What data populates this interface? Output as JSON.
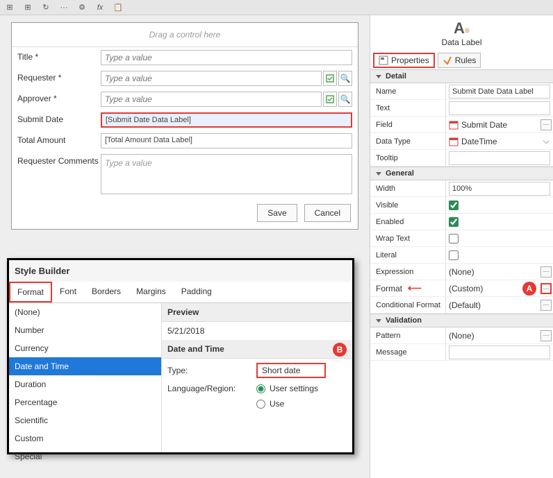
{
  "toolbar": {
    "t1": "⊞",
    "t2": "⊞",
    "t3": "↻",
    "t4": "···",
    "t5": "⚙",
    "t6": "fx",
    "t7": "📋"
  },
  "form": {
    "drag": "Drag a control here",
    "title_label": "Title *",
    "title_ph": "Type a value",
    "requester_label": "Requester *",
    "requester_ph": "Type a value",
    "approver_label": "Approver *",
    "approver_ph": "Type a value",
    "submit_label": "Submit Date",
    "submit_val": "[Submit Date Data Label]",
    "total_label": "Total Amount",
    "total_val": "[Total Amount Data Label]",
    "comments_label": "Requester Comments",
    "comments_ph": "Type a value",
    "save": "Save",
    "cancel": "Cancel"
  },
  "pane": {
    "title": "Data Label",
    "tab_props": "Properties",
    "tab_rules": "Rules",
    "sect_detail": "Detail",
    "name_l": "Name",
    "name_v": "Submit Date Data Label",
    "text_l": "Text",
    "text_v": "",
    "field_l": "Field",
    "field_v": "Submit Date",
    "dtype_l": "Data Type",
    "dtype_v": "DateTime",
    "tooltip_l": "Tooltip",
    "tooltip_v": "",
    "sect_general": "General",
    "width_l": "Width",
    "width_v": "100%",
    "visible_l": "Visible",
    "enabled_l": "Enabled",
    "wrap_l": "Wrap Text",
    "literal_l": "Literal",
    "expr_l": "Expression",
    "expr_v": "(None)",
    "format_l": "Format",
    "format_v": "(Custom)",
    "cformat_l": "Conditional Format",
    "cformat_v": "(Default)",
    "sect_validation": "Validation",
    "pattern_l": "Pattern",
    "pattern_v": "(None)",
    "message_l": "Message",
    "message_v": "",
    "badgeA": "A"
  },
  "dlg": {
    "title": "Style Builder",
    "tabs": [
      "Format",
      "Font",
      "Borders",
      "Margins",
      "Padding"
    ],
    "cats": [
      "(None)",
      "Number",
      "Currency",
      "Date and Time",
      "Duration",
      "Percentage",
      "Scientific",
      "Custom",
      "Special"
    ],
    "cat_sel": 3,
    "preview_h": "Preview",
    "preview_v": "5/21/2018",
    "dt_h": "Date and Time",
    "type_l": "Type:",
    "type_v": "Short date",
    "lang_l": "Language/Region:",
    "opt_user": "User settings",
    "opt_use": "Use",
    "badgeB": "B"
  }
}
